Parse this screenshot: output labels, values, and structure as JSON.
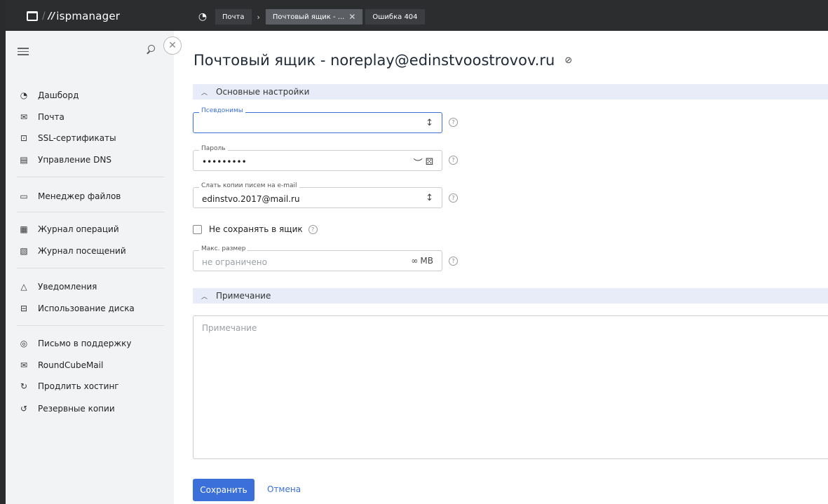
{
  "app": {
    "brand": "ispmanager"
  },
  "tabs": [
    {
      "label": "Почта"
    },
    {
      "label": "Почтовый ящик - ..."
    },
    {
      "label": "Ошибка 404"
    }
  ],
  "sidebar": {
    "groups": [
      [
        {
          "label": "Дашборд",
          "icon": "dashboard-icon"
        },
        {
          "label": "Почта",
          "icon": "mail-icon"
        },
        {
          "label": "SSL-сертификаты",
          "icon": "lock-icon"
        },
        {
          "label": "Управление DNS",
          "icon": "dns-icon"
        }
      ],
      [
        {
          "label": "Менеджер файлов",
          "icon": "folder-icon"
        }
      ],
      [
        {
          "label": "Журнал операций",
          "icon": "operations-log-icon"
        },
        {
          "label": "Журнал посещений",
          "icon": "visits-log-icon"
        }
      ],
      [
        {
          "label": "Уведомления",
          "icon": "bell-icon"
        },
        {
          "label": "Использование диска",
          "icon": "disk-icon"
        }
      ],
      [
        {
          "label": "Письмо в поддержку",
          "icon": "support-icon"
        },
        {
          "label": "RoundCubeMail",
          "icon": "mail-icon"
        },
        {
          "label": "Продлить хостинг",
          "icon": "refresh-icon"
        },
        {
          "label": "Резервные копии",
          "icon": "backup-icon"
        }
      ]
    ]
  },
  "page": {
    "title": "Почтовый ящик - noreplay@edinstvoostrovov.ru"
  },
  "sections": {
    "main": {
      "label": "Основные настройки"
    },
    "note": {
      "label": "Примечание"
    }
  },
  "form": {
    "aliases": {
      "label": "Псевдонимы",
      "value": ""
    },
    "password": {
      "label": "Пароль",
      "value": "•••••••••"
    },
    "forward": {
      "label": "Слать копии писем на e-mail",
      "value": "edinstvo.2017@mail.ru"
    },
    "no_save": {
      "label": "Не сохранять в ящик",
      "checked": false
    },
    "max_size": {
      "label": "Макс. размер",
      "placeholder": "не ограничено",
      "unit": "MB",
      "infinity": "∞"
    },
    "note": {
      "placeholder": "Примечание"
    }
  },
  "buttons": {
    "save": "Сохранить",
    "cancel": "Отмена"
  },
  "colors": {
    "accent": "#3b6fd9",
    "topbar": "#2b2d2f",
    "sidebar": "#f2f3f5",
    "section": "#e7ecf8"
  }
}
